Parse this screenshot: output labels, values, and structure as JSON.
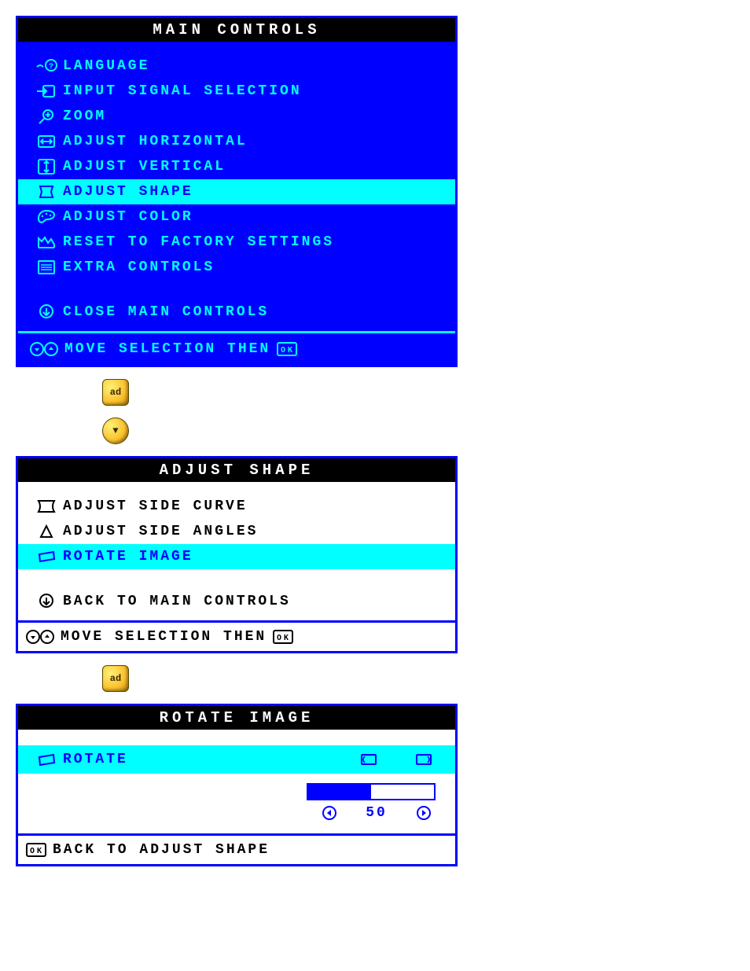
{
  "main": {
    "title": "MAIN CONTROLS",
    "items": [
      {
        "icon": "language",
        "label": "LANGUAGE",
        "sel": false
      },
      {
        "icon": "input",
        "label": "INPUT SIGNAL SELECTION",
        "sel": false
      },
      {
        "icon": "zoom",
        "label": "ZOOM",
        "sel": false
      },
      {
        "icon": "horiz",
        "label": "ADJUST HORIZONTAL",
        "sel": false
      },
      {
        "icon": "vert",
        "label": "ADJUST VERTICAL",
        "sel": false
      },
      {
        "icon": "shape",
        "label": "ADJUST SHAPE",
        "sel": true
      },
      {
        "icon": "color",
        "label": "ADJUST COLOR",
        "sel": false
      },
      {
        "icon": "reset",
        "label": "RESET TO FACTORY SETTINGS",
        "sel": false
      },
      {
        "icon": "extra",
        "label": "EXTRA CONTROLS",
        "sel": false
      }
    ],
    "close_label": "CLOSE MAIN CONTROLS",
    "hint": "MOVE SELECTION THEN"
  },
  "shape": {
    "title": "ADJUST SHAPE",
    "items": [
      {
        "icon": "curve",
        "label": "ADJUST SIDE CURVE",
        "sel": false
      },
      {
        "icon": "angle",
        "label": "ADJUST SIDE ANGLES",
        "sel": false
      },
      {
        "icon": "rotate",
        "label": "ROTATE IMAGE",
        "sel": true
      }
    ],
    "back_label": "BACK TO MAIN CONTROLS",
    "hint": "MOVE SELECTION THEN"
  },
  "rotate": {
    "title": "ROTATE IMAGE",
    "label": "ROTATE",
    "value": "50",
    "fill_percent": 50,
    "back_label": "BACK TO ADJUST SHAPE"
  },
  "buttons": {
    "ok": "ad",
    "down": "▼"
  }
}
